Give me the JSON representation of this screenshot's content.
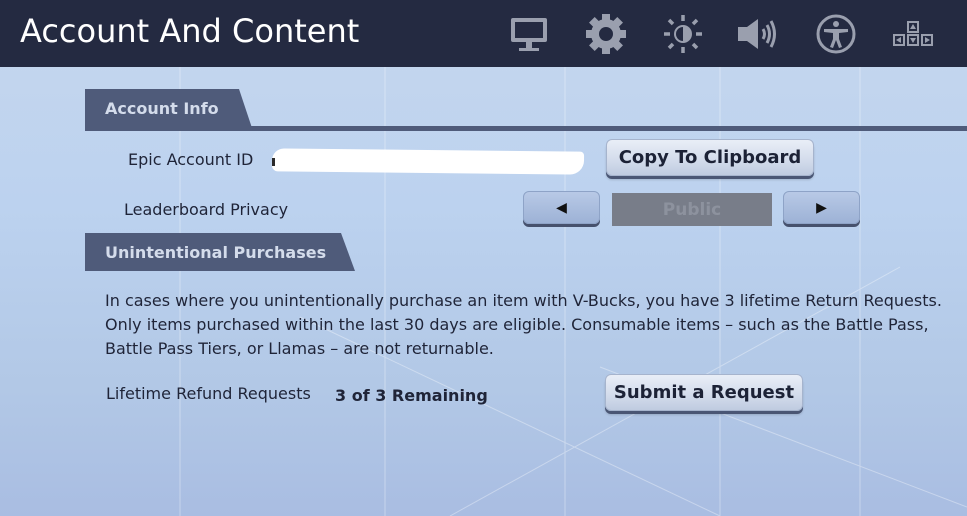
{
  "header": {
    "title": "Account And Content",
    "tabs": [
      {
        "name": "video",
        "icon": "monitor-icon"
      },
      {
        "name": "game",
        "icon": "gear-icon"
      },
      {
        "name": "brightness",
        "icon": "brightness-icon"
      },
      {
        "name": "audio",
        "icon": "speaker-icon"
      },
      {
        "name": "accessibility",
        "icon": "accessibility-icon"
      },
      {
        "name": "input",
        "icon": "input-arrows-icon"
      }
    ]
  },
  "account_info": {
    "section_title": "Account Info",
    "epic_account_id_label": "Epic Account ID",
    "epic_account_id_value": "",
    "copy_button": "Copy To Clipboard",
    "leaderboard_privacy_label": "Leaderboard Privacy",
    "leaderboard_privacy_value": "Public",
    "prev_arrow": "◀",
    "next_arrow": "▶"
  },
  "unintentional_purchases": {
    "section_title": "Unintentional Purchases",
    "description": "In cases where you unintentionally purchase an item with V-Bucks, you have 3 lifetime Return Requests. Only items purchased within the last 30 days are eligible. Consumable items – such as the Battle Pass, Battle Pass Tiers, or Llamas – are not returnable.",
    "refund_label": "Lifetime Refund Requests",
    "refund_remaining": "3 of 3 Remaining",
    "submit_button": "Submit a Request"
  },
  "colors": {
    "topbar": "#242a41",
    "section_header": "#4f5b7a",
    "background": "#c0d4ee",
    "icon": "#9a9fae"
  }
}
